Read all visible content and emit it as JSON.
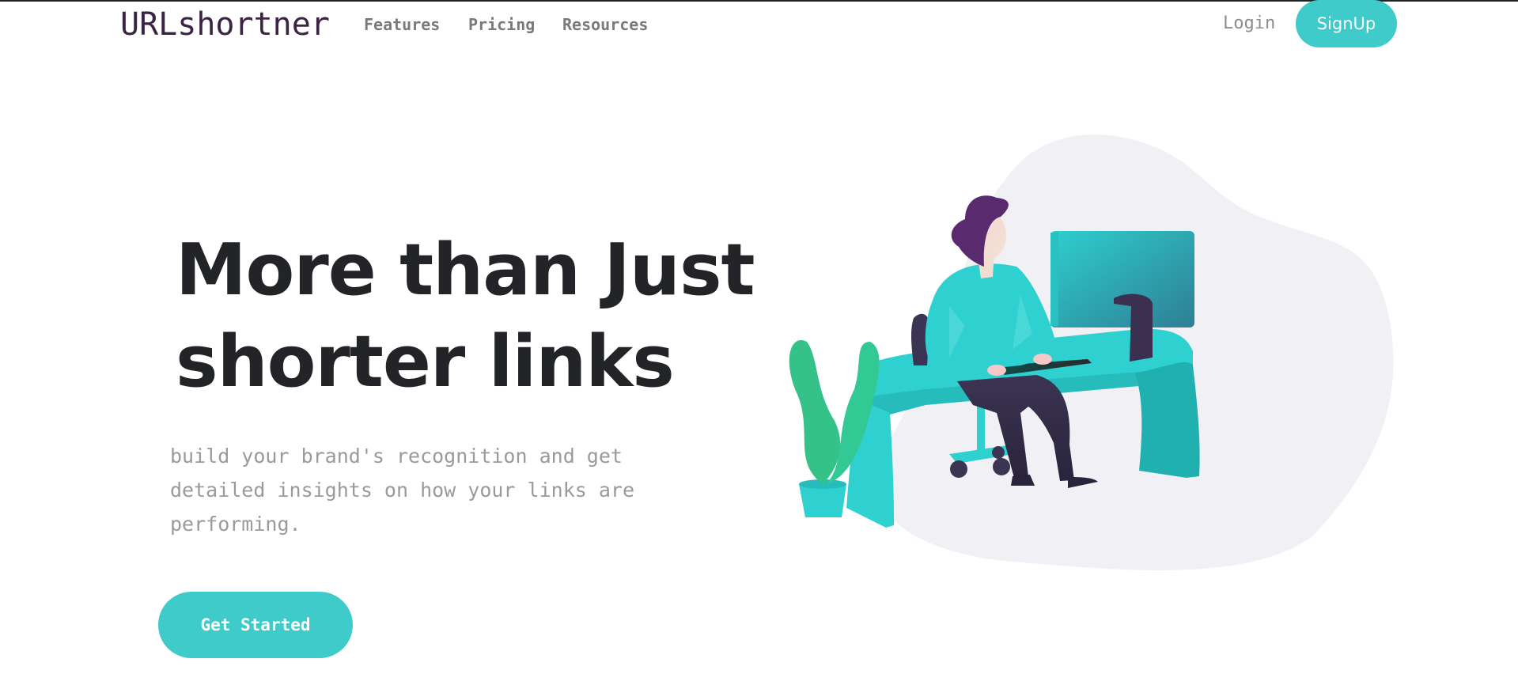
{
  "brand": {
    "logo_text": "URLshortner",
    "accent_color": "#3fcbca",
    "logo_color": "#3b2342"
  },
  "nav": {
    "features": "Features",
    "pricing": "Pricing",
    "resources": "Resources",
    "login": "Login",
    "signup": "SignUp"
  },
  "hero": {
    "headline_line1": "More than Just",
    "headline_line2": "shorter links",
    "subtext": "build your brand's recognition and get detailed insights on how your links are performing.",
    "cta": "Get Started"
  },
  "illustration": {
    "icon": "person-working-at-desk-illustration"
  }
}
